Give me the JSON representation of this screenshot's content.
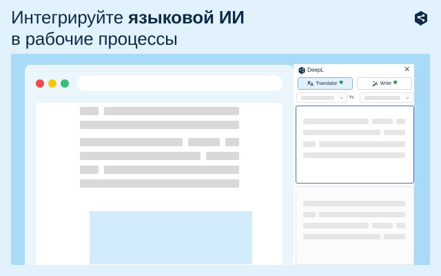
{
  "headline": {
    "line1_prefix": "Интегрируйте ",
    "line1_bold": "языковой ИИ",
    "line2": "в рабочие процессы"
  },
  "colors": {
    "background": "#e1f2fc",
    "stage": "#a9daf8",
    "heading": "#0f2b46",
    "accent_border": "#4d6ea5",
    "highlight": "#d3ecfb"
  },
  "icons": {
    "corner": "deepl-logo-icon",
    "close": "close-icon",
    "translator": "translate-icon",
    "write": "magic-pen-icon",
    "verified": "shield-check-icon",
    "swap": "swap-languages-icon"
  },
  "panel": {
    "brand": "DeepL",
    "close_glyph": "✕",
    "tab_translator": "Translator",
    "tab_write": "Write",
    "verified_glyph": "⛊",
    "chevron_glyph": "⌄",
    "swap_glyph": "⇆"
  }
}
